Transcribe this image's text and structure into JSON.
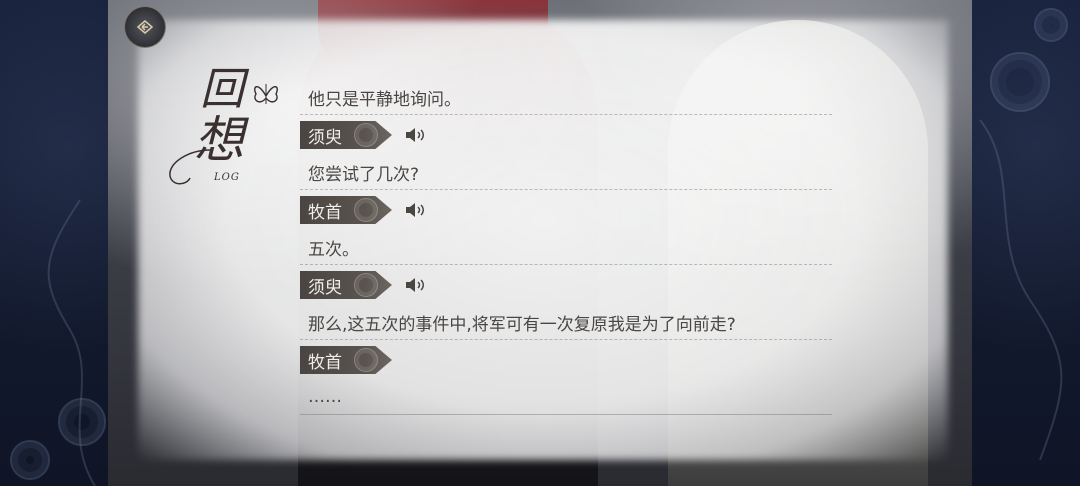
{
  "header": {
    "back_icon": "back-arrow-icon",
    "title_kanji_1": "回",
    "title_kanji_2": "想",
    "title_label": "LOG"
  },
  "log": {
    "entries": [
      {
        "type": "line",
        "text": "他只是平静地询问。"
      },
      {
        "type": "speaker",
        "name": "须臾",
        "voice": true
      },
      {
        "type": "line",
        "text": "您尝试了几次?"
      },
      {
        "type": "speaker",
        "name": "牧首",
        "voice": true
      },
      {
        "type": "line",
        "text": "五次。"
      },
      {
        "type": "speaker",
        "name": "须臾",
        "voice": true
      },
      {
        "type": "line",
        "text": "那么,这五次的事件中,将军可有一次复原我是为了向前走?"
      },
      {
        "type": "speaker",
        "name": "牧首",
        "voice": false
      },
      {
        "type": "line",
        "text": "……"
      }
    ]
  },
  "icons": {
    "voice": "speaker-volume-icon",
    "name_ornament": "rose-icon",
    "title_ornament": "butterfly-icon"
  }
}
